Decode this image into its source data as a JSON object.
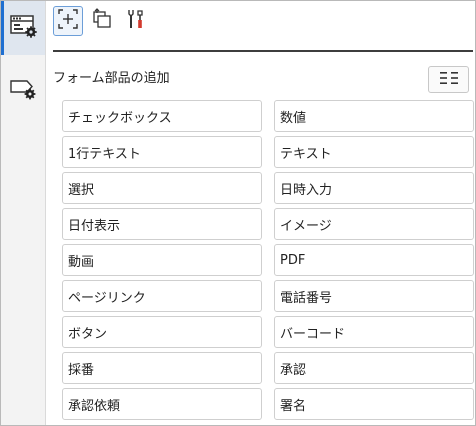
{
  "rail": {
    "items": [
      {
        "icon": "form-settings-icon",
        "selected": true
      },
      {
        "icon": "tag-settings-icon",
        "selected": false
      }
    ]
  },
  "toolbar": {
    "buttons": [
      {
        "icon": "add-frame-icon",
        "active": true
      },
      {
        "icon": "copy-layers-icon",
        "active": false
      },
      {
        "icon": "tools-icon",
        "active": false
      }
    ]
  },
  "panel": {
    "title": "フォーム部品の追加",
    "layout_toggle_icon": "list-layout-icon"
  },
  "parts": [
    "チェックボックス",
    "数値",
    "1行テキスト",
    "テキスト",
    "選択",
    "日時入力",
    "日付表示",
    "イメージ",
    "動画",
    "PDF",
    "ページリンク",
    "電話番号",
    "ボタン",
    "バーコード",
    "採番",
    "承認",
    "承認依頼",
    "署名"
  ],
  "colors": {
    "accent": "#1f6fd1",
    "selected_bg": "#dfe6ef",
    "border": "#cfcfcf"
  }
}
